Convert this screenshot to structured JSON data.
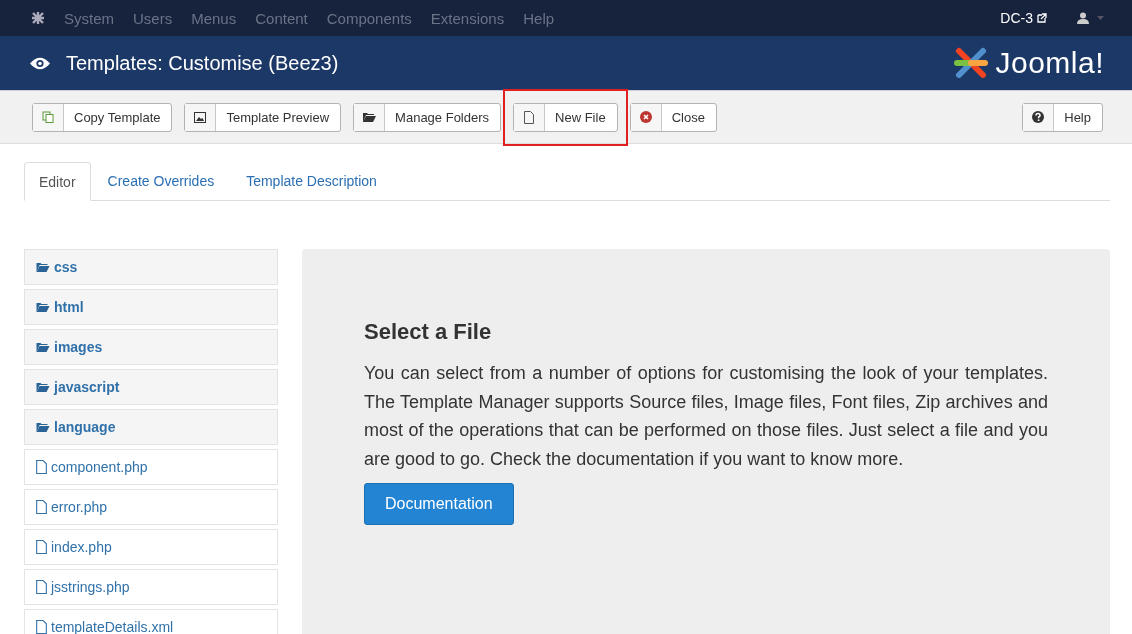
{
  "top_menu": {
    "items": [
      "System",
      "Users",
      "Menus",
      "Content",
      "Components",
      "Extensions",
      "Help"
    ],
    "site_link": "DC-3"
  },
  "header": {
    "title": "Templates: Customise (Beez3)",
    "logo_text": "Joomla!"
  },
  "toolbar": {
    "buttons": [
      {
        "label": "Copy Template",
        "kind": "copy",
        "highlighted": false
      },
      {
        "label": "Template Preview",
        "kind": "preview",
        "highlighted": false
      },
      {
        "label": "Manage Folders",
        "kind": "folder",
        "highlighted": false
      },
      {
        "label": "New File",
        "kind": "file",
        "highlighted": true
      },
      {
        "label": "Close",
        "kind": "close",
        "highlighted": false
      }
    ],
    "help": {
      "label": "Help",
      "kind": "help"
    }
  },
  "tabs": [
    {
      "label": "Editor",
      "selected": true
    },
    {
      "label": "Create Overrides",
      "selected": false
    },
    {
      "label": "Template Description",
      "selected": false
    }
  ],
  "files": [
    {
      "name": "css",
      "kind": "folder"
    },
    {
      "name": "html",
      "kind": "folder"
    },
    {
      "name": "images",
      "kind": "folder"
    },
    {
      "name": "javascript",
      "kind": "folder"
    },
    {
      "name": "language",
      "kind": "folder"
    },
    {
      "name": "component.php",
      "kind": "file"
    },
    {
      "name": "error.php",
      "kind": "file"
    },
    {
      "name": "index.php",
      "kind": "file"
    },
    {
      "name": "jsstrings.php",
      "kind": "file"
    },
    {
      "name": "templateDetails.xml",
      "kind": "file"
    }
  ],
  "panel": {
    "heading": "Select a File",
    "text": "You can select from a number of options for customising the look of your templates. The Template Manager supports Source files, Image files, Font files, Zip archives and most of the operations that can be performed on those files. Just select a file and you are good to go. Check the documentation if you want to know more.",
    "button": "Documentation"
  }
}
